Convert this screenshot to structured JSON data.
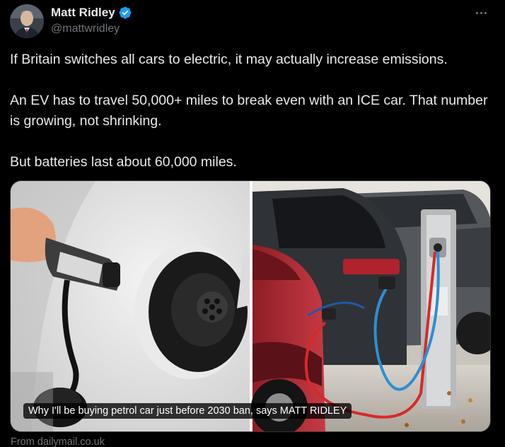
{
  "author": {
    "name": "Matt Ridley",
    "handle": "@mattwridley",
    "verified": true,
    "avatar_icon": "avatar-photo"
  },
  "tweet": {
    "paragraphs": [
      "If Britain switches all cars to electric, it may actually increase emissions.",
      "An EV has to travel 50,000+ miles to break even with an ICE car. That number is growing, not shrinking.",
      "But batteries last about 60,000 miles."
    ]
  },
  "card": {
    "caption": "Why I'll be buying petrol car just before 2030 ban, says MATT RIDLEY",
    "source": "From dailymail.co.uk",
    "image_description_icon": "ev-charging-photo"
  },
  "colors": {
    "background": "#000000",
    "text": "#e7e9ea",
    "muted": "#71767b",
    "verified_blue": "#1d9bf0",
    "border": "#2f3336"
  },
  "icons": {
    "verified": "verified-badge-icon",
    "more": "more-options-icon"
  }
}
